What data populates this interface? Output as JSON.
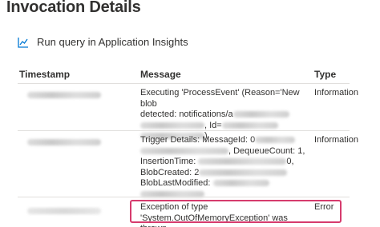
{
  "title": "Invocation Details",
  "toolbar": {
    "run_query_label": "Run query in Application Insights",
    "run_query_icon": "line-chart-icon"
  },
  "table": {
    "columns": [
      "Timestamp",
      "Message",
      "Type"
    ],
    "rows": [
      {
        "message_lines": [
          "Executing 'ProcessEvent' (Reason='New blob",
          "detected: notifications/a",
          ", Id=",
          ")"
        ],
        "type": "Information"
      },
      {
        "message_lines": [
          "Trigger Details: MessageId: 0",
          ", DequeueCount: 1,",
          "InsertionTime: ",
          "0,",
          "BlobCreated: 2",
          "BlobLastModified: ",
          ""
        ],
        "type": "Information"
      },
      {
        "message_lines": [
          "Exception of type",
          "'System.OutOfMemoryException' was thrown."
        ],
        "type": "Error"
      }
    ]
  },
  "colors": {
    "highlight_border": "#d63b6d",
    "icon_blue": "#0078d4"
  }
}
